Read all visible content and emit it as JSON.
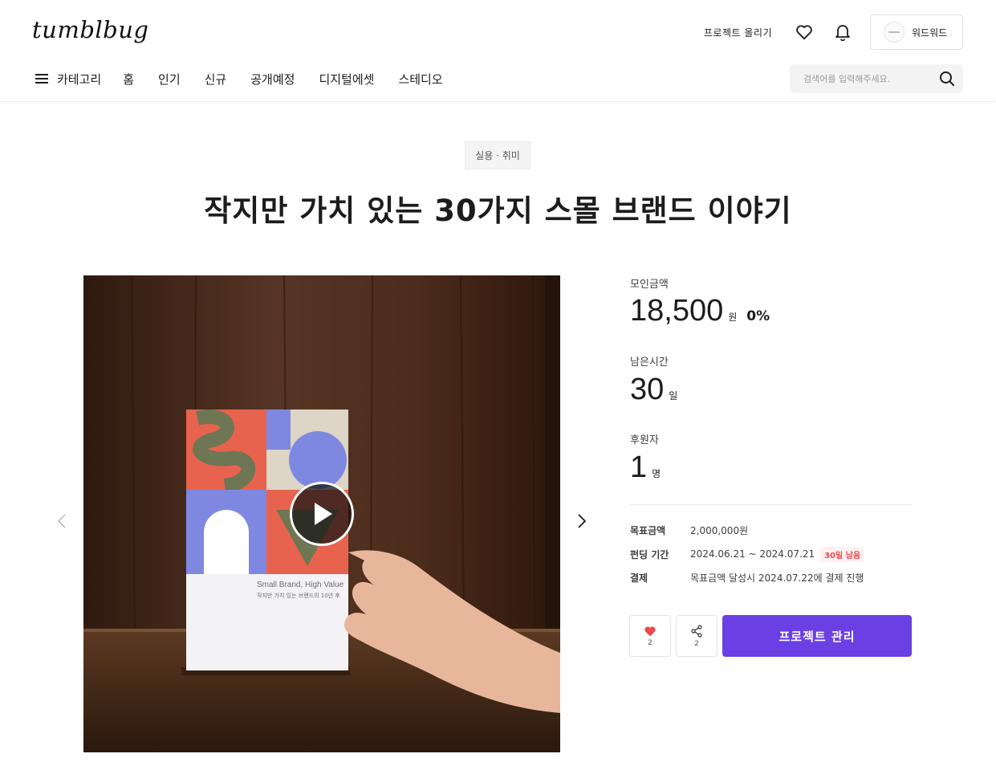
{
  "header": {
    "logo": "tumblbug",
    "upload_label": "프로젝트 올리기",
    "profile_name": "워드워드"
  },
  "nav": {
    "items": [
      {
        "label": "카테고리"
      },
      {
        "label": "홈"
      },
      {
        "label": "인기"
      },
      {
        "label": "신규"
      },
      {
        "label": "공개예정"
      },
      {
        "label": "디지털에셋"
      },
      {
        "label": "스테디오"
      }
    ],
    "search_placeholder": "검색어를 입력해주세요."
  },
  "project": {
    "category": "실용 · 취미",
    "title": "작지만 가치 있는 30가지 스몰 브랜드 이야기",
    "book_title_en": "Small Brand, High Value",
    "book_subtitle_ko": "작지만 가치 있는 브랜드의 10년 후"
  },
  "stats": {
    "raised_label": "모인금액",
    "raised_value": "18,500",
    "raised_unit": "원",
    "raised_percent": "0%",
    "time_label": "남은시간",
    "time_value": "30",
    "time_unit": "일",
    "backers_label": "후원자",
    "backers_value": "1",
    "backers_unit": "명"
  },
  "info": {
    "goal_label": "목표금액",
    "goal_value": "2,000,000원",
    "period_label": "펀딩 기간",
    "period_value": "2024.06.21 ~ 2024.07.21",
    "period_badge": "30일 남음",
    "payment_label": "결제",
    "payment_value": "목표금액 달성시 2024.07.22에 결제 진행"
  },
  "actions": {
    "like_count": "2",
    "share_count": "2",
    "manage_label": "프로젝트 관리"
  },
  "colors": {
    "accent": "#6a3fe4",
    "heart": "#f1464d",
    "badge_bg": "#fff1f1"
  }
}
